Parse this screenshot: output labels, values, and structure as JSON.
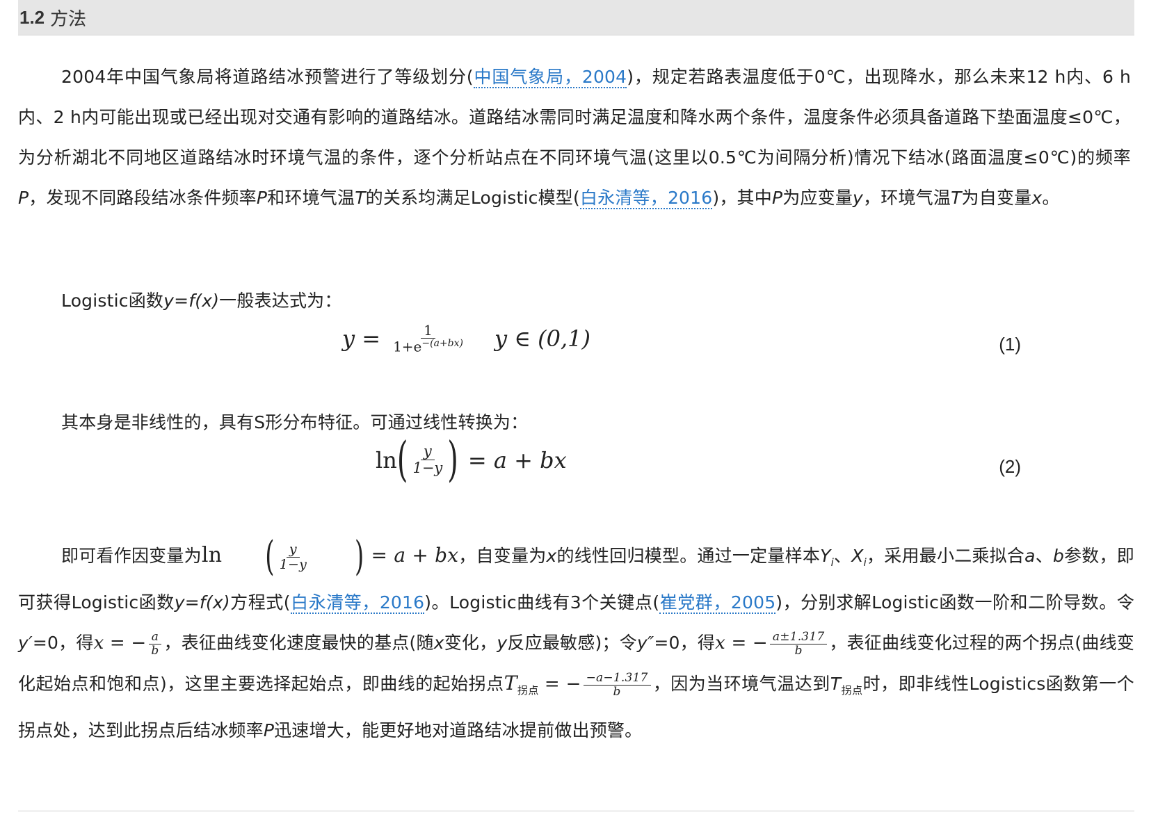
{
  "section": {
    "number": "1.2",
    "title": "方法"
  },
  "para1": {
    "t1": "2004年中国气象局将道路结冰预警进行了等级划分(",
    "cite1": "中国气象局，2004",
    "t2": ")，规定若路表温度低于0℃，出现降水，那么未来12 h内、6 h内、2 h内可能出现或已经出现对交通有影响的道路结冰。道路结冰需同时满足温度和降水两个条件，温度条件必须具备道路下垫面温度≤0℃，为分析湖北不同地区道路结冰时环境气温的条件，逐个分析站点在不同环境气温(这里以0.5℃为间隔分析)情况下结冰(路面温度≤0℃)的频率",
    "P1": "P",
    "t3": "，发现不同路段结冰条件频率",
    "P2": "P",
    "t4": "和环境气温",
    "T1": "T",
    "t5": "的关系均满足Logistic模型(",
    "cite2": "白永清等，2016",
    "t6": ")，其中",
    "P3": "P",
    "t7": "为应变量",
    "y1": "y",
    "t8": "，环境气温",
    "T2": "T",
    "t9": "为自变量",
    "x1": "x",
    "t10": "。"
  },
  "para2": {
    "t1": "Logistic函数",
    "f": "y=f(x)",
    "t2": "一般表达式为："
  },
  "eq1": {
    "lhs": "y =",
    "num": "1",
    "den": "1+e",
    "exp": "−(a+bx)",
    "cond": "y ∈ (0,1)",
    "number": "(1)"
  },
  "para3": {
    "text": "其本身是非线性的，具有S形分布特征。可通过线性转换为："
  },
  "eq2": {
    "ln": "ln",
    "num": "y",
    "den": "1−y",
    "rhs": "= a + bx",
    "number": "(2)"
  },
  "para4": {
    "t1": "即可看作因变量为",
    "ln": "ln",
    "fnum": "y",
    "fden": "1−y",
    "rhs": "= a + bx",
    "t2": "，自变量为",
    "x": "x",
    "t3": "的线性回归模型。通过一定量样本",
    "Yi": "Y",
    "i1": "i",
    "sep": "、",
    "Xi": "X",
    "i2": "i",
    "t4": "，采用最小二乘拟合",
    "a": "a",
    "t5": "、",
    "b": "b",
    "t6": "参数，即可获得Logistic函数",
    "f": "y=f(x)",
    "t7": "方程式(",
    "cite1": "白永清等，2016",
    "t8": ")。Logistic曲线有3个关键点(",
    "cite2": "崔党群，2005",
    "t9": ")，分别求解Logistic函数一阶和二阶导数。令",
    "yp": "y′",
    "t10": "=0，得",
    "xeq": "x = −",
    "f1n": "a",
    "f1d": "b",
    "t11": "，表征曲线变化速度最快的基点(随",
    "x2": "x",
    "t12": "变化，",
    "y2": "y",
    "t13": "反应最敏感)；令",
    "ypp": "y″",
    "t14": "=0，得",
    "xeq2": "x = −",
    "f2n": "a±1.317",
    "f2d": "b",
    "t15": "，表征曲线变化过程的两个拐点(曲线变化起始点和饱和点)，这里主要选择起始点，即曲线的起始拐点",
    "T": "T",
    "sub": "拐点",
    "eq3": "= −",
    "f3n": "−a−1.317",
    "f3d": "b",
    "t16": "，因为当环境气温达到",
    "T2": "T",
    "sub2": "拐点",
    "t17": "时，即非线性Logistics函数第一个拐点处，达到此拐点后结冰频率",
    "P": "P",
    "t18": "迅速增大，能更好地对道路结冰提前做出预警。"
  }
}
